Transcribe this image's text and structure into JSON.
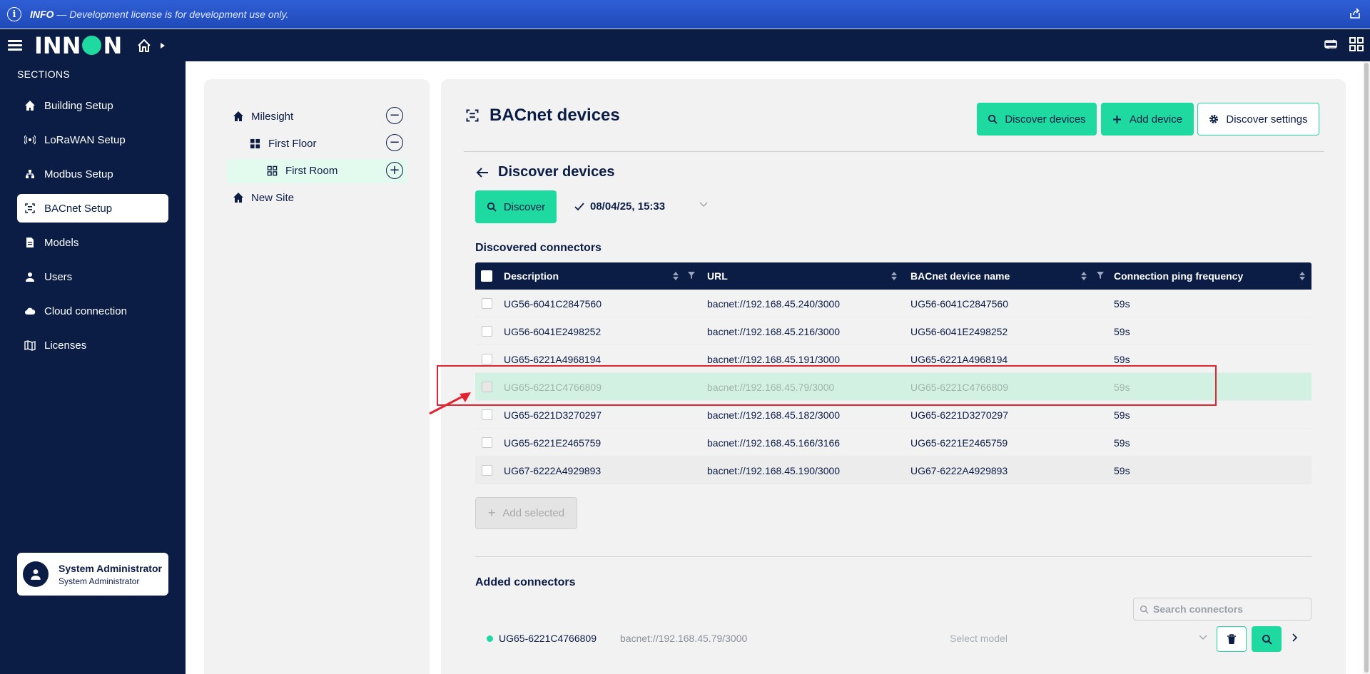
{
  "info_bar": {
    "prefix": "INFO",
    "separator": "—",
    "message": "Development license is for development use only."
  },
  "sidebar": {
    "sections_label": "SECTIONS",
    "items": [
      {
        "label": "Building Setup",
        "icon": "home-icon",
        "active": false
      },
      {
        "label": "LoRaWAN Setup",
        "icon": "antenna-icon",
        "active": false
      },
      {
        "label": "Modbus Setup",
        "icon": "network-icon",
        "active": false
      },
      {
        "label": "BACnet Setup",
        "icon": "bacnet-icon",
        "active": true
      },
      {
        "label": "Models",
        "icon": "document-icon",
        "active": false
      },
      {
        "label": "Users",
        "icon": "user-icon",
        "active": false
      },
      {
        "label": "Cloud connection",
        "icon": "cloud-icon",
        "active": false
      },
      {
        "label": "Licenses",
        "icon": "map-icon",
        "active": false
      }
    ],
    "user": {
      "name": "System Administrator",
      "role": "System Administrator"
    }
  },
  "tree": {
    "nodes": [
      {
        "label": "Milesight",
        "icon": "home-icon",
        "action": "collapse"
      },
      {
        "label": "First Floor",
        "icon": "floor-icon",
        "action": "collapse"
      },
      {
        "label": "First Room",
        "icon": "room-icon",
        "action": "add"
      },
      {
        "label": "New Site",
        "icon": "home-icon",
        "action": ""
      }
    ]
  },
  "header": {
    "title": "BACnet devices",
    "discover_devices_label": "Discover devices",
    "add_device_label": "Add device",
    "discover_settings_label": "Discover settings"
  },
  "discover": {
    "title": "Discover devices",
    "discover_button": "Discover",
    "last_run": "08/04/25, 15:33"
  },
  "discovered": {
    "title": "Discovered connectors",
    "columns": [
      "Description",
      "URL",
      "BACnet device name",
      "Connection ping frequency"
    ],
    "rows": [
      {
        "description": "UG56-6041C2847560",
        "url": "bacnet://192.168.45.240/3000",
        "device_name": "UG56-6041C2847560",
        "ping": "59s"
      },
      {
        "description": "UG56-6041E2498252",
        "url": "bacnet://192.168.45.216/3000",
        "device_name": "UG56-6041E2498252",
        "ping": "59s"
      },
      {
        "description": "UG65-6221A4968194",
        "url": "bacnet://192.168.45.191/3000",
        "device_name": "UG65-6221A4968194",
        "ping": "59s"
      },
      {
        "description": "UG65-6221C4766809",
        "url": "bacnet://192.168.45.79/3000",
        "device_name": "UG65-6221C4766809",
        "ping": "59s"
      },
      {
        "description": "UG65-6221D3270297",
        "url": "bacnet://192.168.45.182/3000",
        "device_name": "UG65-6221D3270297",
        "ping": "59s"
      },
      {
        "description": "UG65-6221E2465759",
        "url": "bacnet://192.168.45.166/3166",
        "device_name": "UG65-6221E2465759",
        "ping": "59s"
      },
      {
        "description": "UG67-6222A4929893",
        "url": "bacnet://192.168.45.190/3000",
        "device_name": "UG67-6222A4929893",
        "ping": "59s"
      }
    ],
    "add_selected_label": "Add selected"
  },
  "added": {
    "title": "Added connectors",
    "search_placeholder": "Search connectors",
    "rows": [
      {
        "name": "UG65-6221C4766809",
        "url": "bacnet://192.168.45.79/3000",
        "model_placeholder": "Select model"
      }
    ]
  },
  "colors": {
    "navy": "#0b1d45",
    "accent_green": "#1ed9a0",
    "info_blue": "#2353c8",
    "annotation_red": "#e3232f"
  }
}
